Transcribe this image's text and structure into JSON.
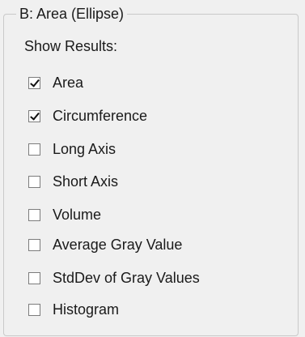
{
  "group": {
    "title": "B: Area (Ellipse)",
    "section_label": "Show Results:"
  },
  "options": [
    {
      "label": "Area",
      "checked": true
    },
    {
      "label": "Circumference",
      "checked": true
    },
    {
      "label": "Long Axis",
      "checked": false
    },
    {
      "label": "Short Axis",
      "checked": false
    },
    {
      "label": "Volume",
      "checked": false
    },
    {
      "label": "Average Gray Value",
      "checked": false
    },
    {
      "label": "StdDev of Gray Values",
      "checked": false
    },
    {
      "label": "Histogram",
      "checked": false
    }
  ]
}
